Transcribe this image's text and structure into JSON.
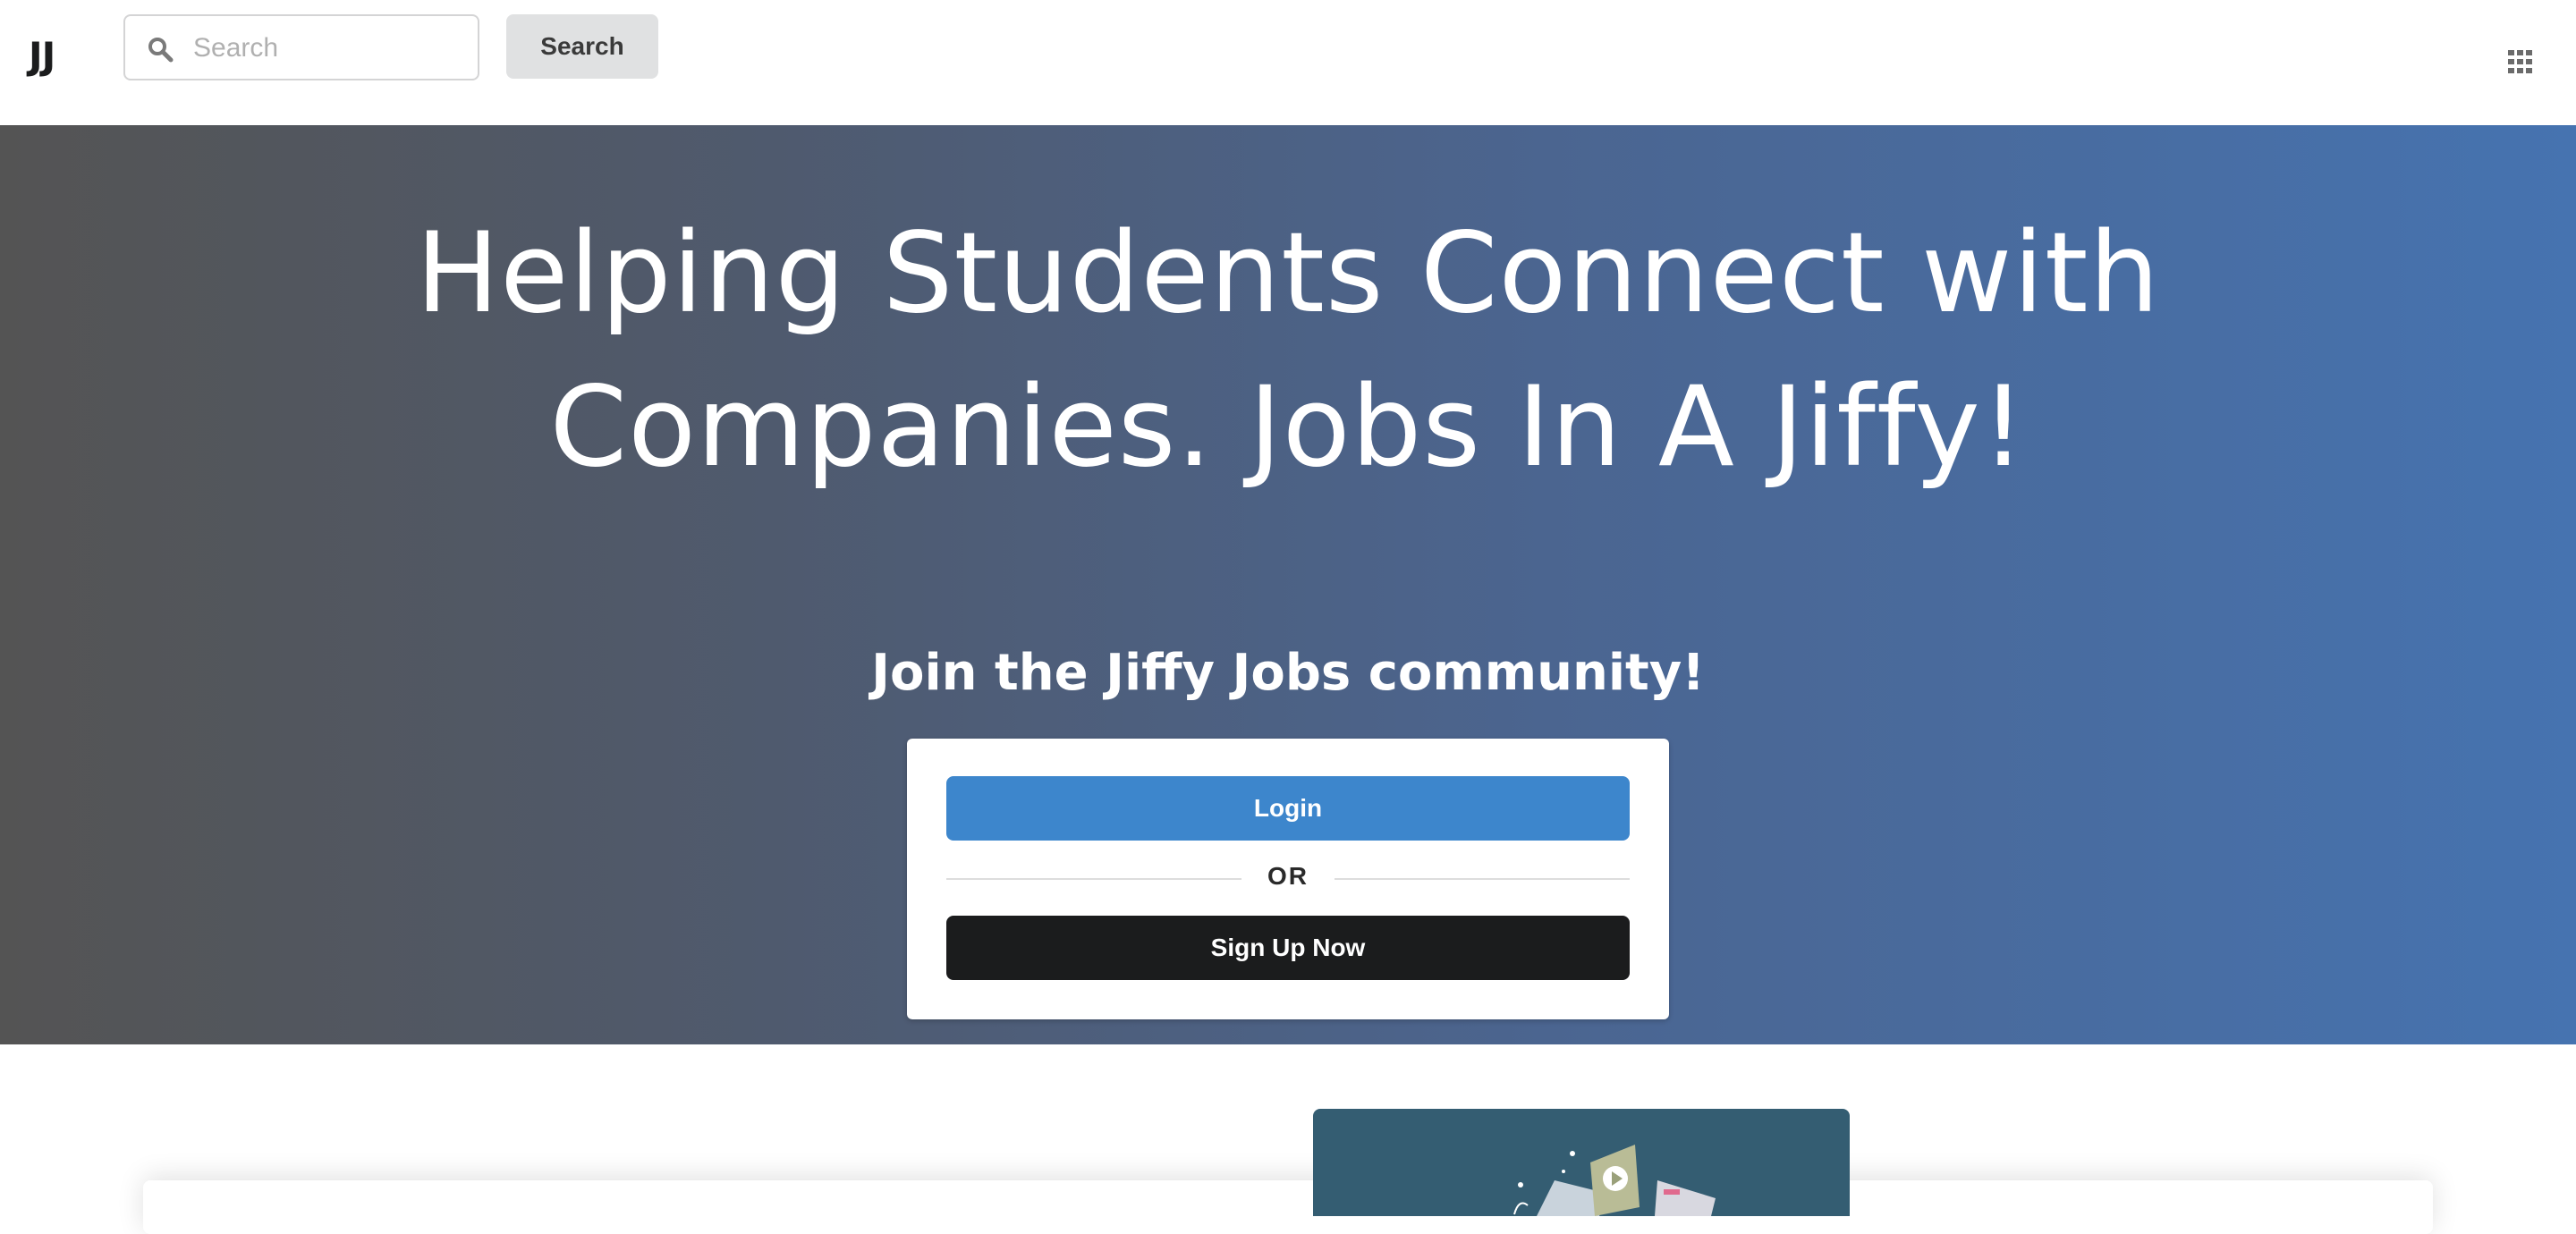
{
  "header": {
    "logo": "JJ",
    "search": {
      "placeholder": "Search",
      "value": ""
    },
    "search_button_label": "Search",
    "apps_icon": "grid-icon"
  },
  "hero": {
    "title": "Helping Students Connect with Companies. Jobs In A Jiffy!",
    "join_heading": "Join the Jiffy Jobs community!",
    "login_label": "Login",
    "divider_text": "OR",
    "signup_label": "Sign Up Now",
    "gradient_colors": [
      "#545454",
      "#4673b0"
    ]
  },
  "colors": {
    "login_button": "#3d86cc",
    "signup_button": "#1b1c1d",
    "illustration_bg": "#345d72"
  }
}
